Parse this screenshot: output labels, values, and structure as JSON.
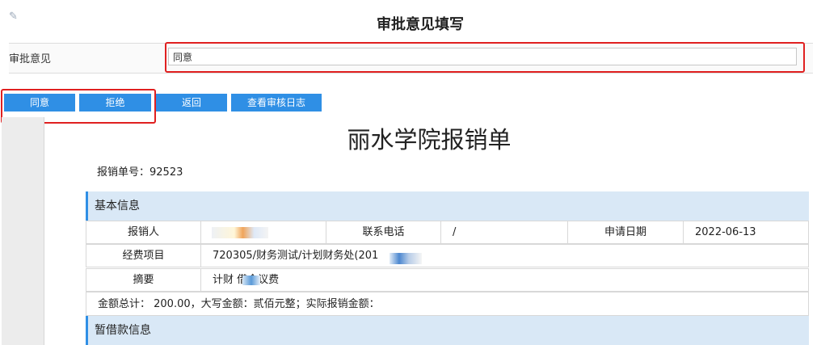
{
  "header": {
    "title": "审批意见填写"
  },
  "opinion": {
    "label": "审批意见",
    "value": "同意"
  },
  "buttons": {
    "agree": "同意",
    "reject": "拒绝",
    "back": "返回",
    "view_log": "查看审核日志"
  },
  "form": {
    "title": "丽水学院报销单",
    "number_label": "报销单号：",
    "number": "92523",
    "basic_section": "基本信息",
    "fields": {
      "applicant_label": "报销人",
      "applicant_value": "",
      "phone_label": "联系电话",
      "phone_value": "/",
      "date_label": "申请日期",
      "date_value": "2022-06-13",
      "project_label": "经费项目",
      "project_value": "720305/财务测试/计划财务处(201",
      "summary_label": "摘要",
      "summary_value": "计财  借会议费"
    },
    "total_line": "金额总计： 200.00，大写金额：贰佰元整；实际报销金额：",
    "loan_section": "暂借款信息"
  }
}
